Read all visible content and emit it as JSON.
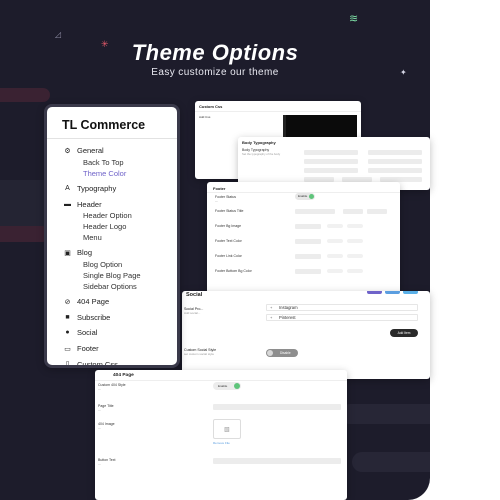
{
  "hero": {
    "title": "Theme Options",
    "subtitle": "Easy customize our theme"
  },
  "sidebar": {
    "title": "TL Commerce",
    "items": [
      {
        "label": "General",
        "icon": "gear-icon",
        "glyph": "⚙",
        "subs": [
          {
            "label": "Back To Top",
            "active": false
          },
          {
            "label": "Theme Color",
            "active": true
          }
        ]
      },
      {
        "label": "Typography",
        "icon": "font-icon",
        "glyph": "A",
        "subs": []
      },
      {
        "label": "Header",
        "icon": "header-icon",
        "glyph": "▬",
        "subs": [
          {
            "label": "Header Option",
            "active": false
          },
          {
            "label": "Header Logo",
            "active": false
          },
          {
            "label": "Menu",
            "active": false
          }
        ]
      },
      {
        "label": "Blog",
        "icon": "blog-icon",
        "glyph": "▣",
        "subs": [
          {
            "label": "Blog Option",
            "active": false
          },
          {
            "label": "Single Blog Page",
            "active": false
          },
          {
            "label": "Sidebar Options",
            "active": false
          }
        ]
      },
      {
        "label": "404 Page",
        "icon": "not-found-icon",
        "glyph": "⊘",
        "subs": []
      },
      {
        "label": "Subscribe",
        "icon": "subscribe-icon",
        "glyph": "■",
        "subs": []
      },
      {
        "label": "Social",
        "icon": "social-icon",
        "glyph": "●",
        "subs": []
      },
      {
        "label": "Footer",
        "icon": "footer-icon",
        "glyph": "▭",
        "subs": []
      },
      {
        "label": "Custom Css",
        "icon": "code-icon",
        "glyph": "▯",
        "subs": []
      }
    ]
  },
  "custom_css": {
    "title": "Custom Css",
    "field_label": "Add Css"
  },
  "body_typography": {
    "title": "Body Typography",
    "row_label": "Body Typography",
    "row_sublabel": "Set the typography of the body"
  },
  "footer_panel": {
    "title": "Footer",
    "footer_status_label": "Footer Status",
    "toggle_label": "Enable",
    "rows": [
      {
        "label": "Footer Status Title",
        "has_radios": false
      },
      {
        "label": "Footer Bg Image",
        "has_radios": true
      },
      {
        "label": "Footer Text Color",
        "has_radios": true
      },
      {
        "label": "Footer Link Color",
        "has_radios": true
      },
      {
        "label": "Footer Bottom Bg Color",
        "has_radios": true
      }
    ]
  },
  "social_panel": {
    "title": "Social",
    "section_label": "Social Pro...",
    "section_sublabel": "Add social...",
    "networks": [
      "Instagram",
      "Pinterest"
    ],
    "add_button": "Add Item",
    "custom_style_label": "Custom Social Style",
    "custom_style_sublabel": "set custom social style",
    "disable_label": "Disable"
  },
  "page404": {
    "title": "404 Page",
    "custom_style_label": "Custom 404 Style",
    "enable_label": "Enable",
    "page_title_label": "Page Title",
    "image_label": "404 Image",
    "remove_label": "Remove File",
    "button_text_label": "Button Text"
  },
  "colors": {
    "background": "#1d1c2b",
    "accent": "#6f63c9",
    "toggle_green": "#5ec47a"
  }
}
